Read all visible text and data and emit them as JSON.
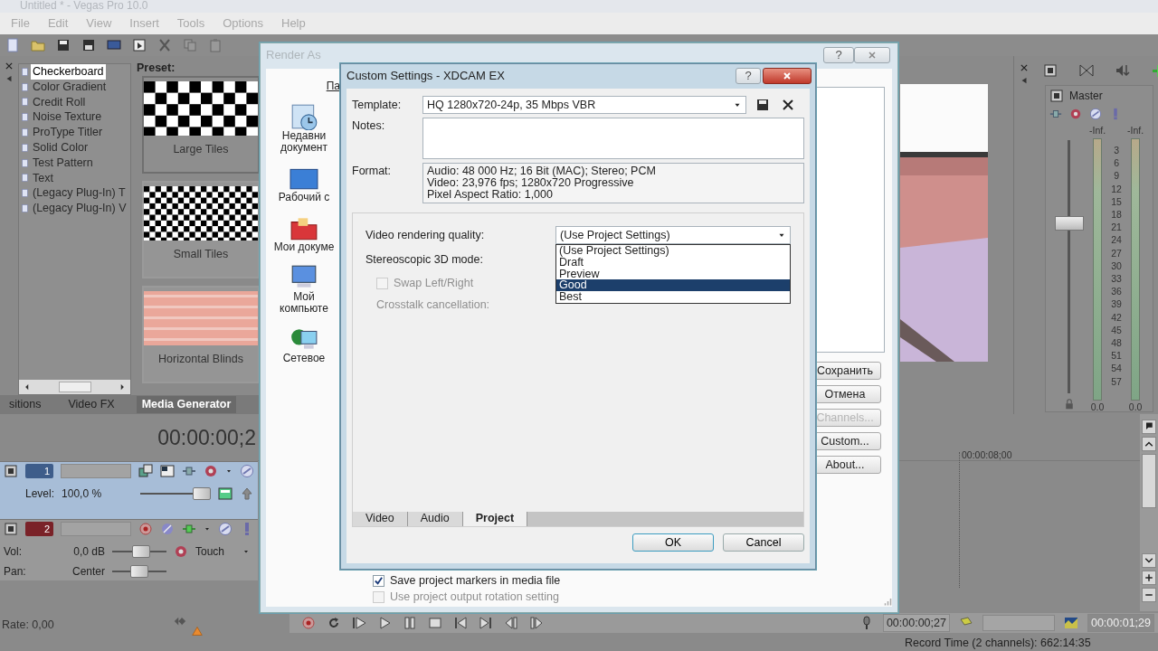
{
  "app": {
    "title": "Untitled * - Vegas Pro 10.0",
    "menu": [
      "File",
      "Edit",
      "View",
      "Insert",
      "Tools",
      "Options",
      "Help"
    ]
  },
  "generators": {
    "items": [
      {
        "label": "Checkerboard",
        "selected": true
      },
      {
        "label": "Color Gradient",
        "selected": false
      },
      {
        "label": "Credit Roll",
        "selected": false
      },
      {
        "label": "Noise Texture",
        "selected": false
      },
      {
        "label": "ProType Titler",
        "selected": false
      },
      {
        "label": "Solid Color",
        "selected": false
      },
      {
        "label": "Test Pattern",
        "selected": false
      },
      {
        "label": "Text",
        "selected": false
      },
      {
        "label": "(Legacy Plug-In) T",
        "selected": false
      },
      {
        "label": "(Legacy Plug-In) V",
        "selected": false
      }
    ],
    "preset_label": "Preset:",
    "presets": [
      {
        "label": "Large Tiles",
        "kind": "large-checker",
        "selected": true
      },
      {
        "label": "Small Tiles",
        "kind": "small-checker",
        "selected": false
      },
      {
        "label": "Horizontal Blinds",
        "kind": "blinds",
        "selected": false
      }
    ]
  },
  "dock_tabs": [
    {
      "label": "sitions",
      "selected": false
    },
    {
      "label": "Video FX",
      "selected": false
    },
    {
      "label": "Media Generator",
      "selected": true
    }
  ],
  "timeline": {
    "time": "00:00:00;2",
    "ruler_time": "00:00:08;00",
    "rate": "Rate: 0,00",
    "tracks": [
      {
        "kind": "video",
        "number": "1",
        "label": "Level:",
        "value": "100,0 %",
        "level": 1.0
      },
      {
        "kind": "audio",
        "number": "2",
        "label": "Vol:",
        "value": "0,0 dB",
        "level": 0.55,
        "pan": {
          "label": "Pan:",
          "value": "Center",
          "level": 0.5
        },
        "automation": "Touch"
      }
    ]
  },
  "master": {
    "title": "Master",
    "peaks": [
      "-Inf.",
      "-Inf."
    ],
    "scale": [
      "3",
      "6",
      "9",
      "12",
      "15",
      "18",
      "21",
      "24",
      "27",
      "30",
      "33",
      "36",
      "39",
      "42",
      "45",
      "48",
      "51",
      "54",
      "57"
    ],
    "readings": [
      "0.0",
      "0.0"
    ],
    "level": 0.68
  },
  "transport": {
    "time": "00:00:00;27",
    "end_time": "00:00:01;29"
  },
  "status_bar": "Record Time (2 channels): 662:14:35",
  "render_as": {
    "title": "Render As",
    "help": "?",
    "path_label": "Па",
    "places": [
      {
        "lines": [
          "Недавни",
          "документ"
        ],
        "kind": "recent"
      },
      {
        "lines": [
          "Рабочий с"
        ],
        "kind": "desktop"
      },
      {
        "lines": [
          "Мои докуме"
        ],
        "kind": "documents"
      },
      {
        "lines": [
          "Мой",
          "компьюте"
        ],
        "kind": "computer"
      },
      {
        "lines": [
          "Сетевое"
        ],
        "kind": "network"
      }
    ],
    "buttons": [
      {
        "label": "Сохранить",
        "disabled": false
      },
      {
        "label": "Отмена",
        "disabled": false
      },
      {
        "label": "Channels...",
        "disabled": true
      },
      {
        "label": "Custom...",
        "disabled": false
      },
      {
        "label": "About...",
        "disabled": false
      }
    ],
    "options": [
      {
        "label": "Save project markers in media file",
        "checked": true,
        "disabled": false
      },
      {
        "label": "Use project output rotation setting",
        "checked": false,
        "disabled": true
      }
    ]
  },
  "custom_settings": {
    "title": "Custom Settings - XDCAM EX",
    "help": "?",
    "template_label": "Template:",
    "template": "HQ 1280x720-24p, 35 Mbps VBR",
    "notes_label": "Notes:",
    "format_label": "Format:",
    "format_lines": [
      "Audio: 48 000 Hz; 16 Bit (MAC); Stereo; PCM",
      "Video: 23,976 fps; 1280x720 Progressive",
      "Pixel Aspect Ratio: 1,000"
    ],
    "quality_label": "Video rendering quality:",
    "quality": "(Use Project Settings)",
    "quality_options": [
      {
        "label": "(Use Project Settings)",
        "selected": false
      },
      {
        "label": "Draft",
        "selected": false
      },
      {
        "label": "Preview",
        "selected": false
      },
      {
        "label": "Good",
        "selected": true
      },
      {
        "label": "Best",
        "selected": false
      }
    ],
    "stereo_label": "Stereoscopic 3D mode:",
    "swap": {
      "label": "Swap Left/Right",
      "checked": false,
      "disabled": true
    },
    "crosstalk_label": "Crosstalk cancellation:",
    "tabs": [
      {
        "label": "Video",
        "selected": false
      },
      {
        "label": "Audio",
        "selected": false
      },
      {
        "label": "Project",
        "selected": true
      }
    ],
    "buttons": [
      "OK",
      "Cancel"
    ]
  }
}
